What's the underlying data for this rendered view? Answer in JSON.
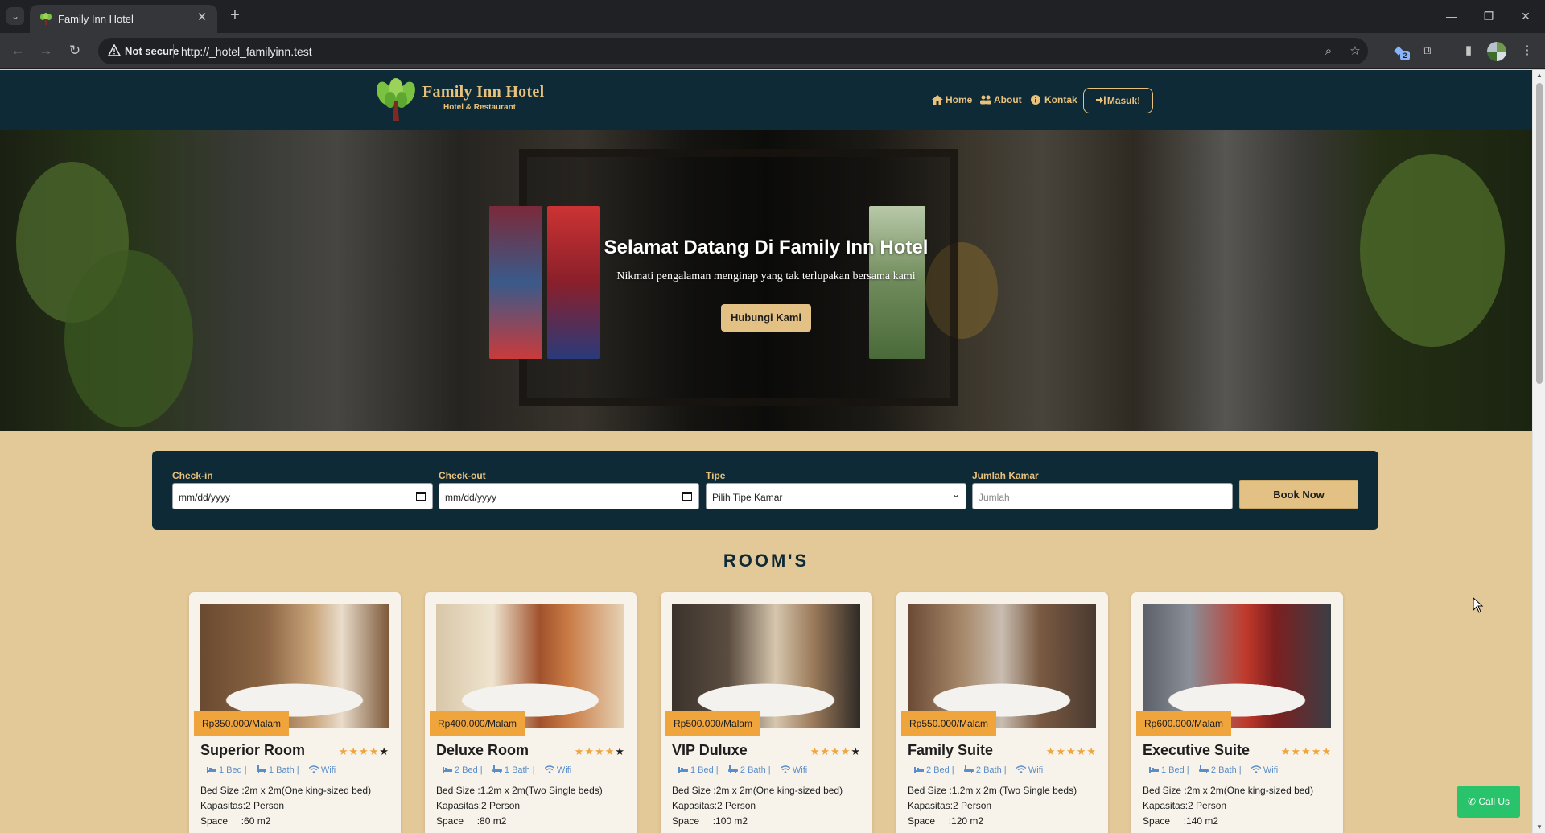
{
  "browser": {
    "tab_title": "Family Inn Hotel",
    "security_label": "Not secure",
    "url": "http://_hotel_familyinn.test",
    "extension_badge": "2"
  },
  "site": {
    "brand_name": "Family Inn Hotel",
    "brand_tagline": "Hotel & Restaurant",
    "nav": {
      "home": "Home",
      "about": "About",
      "contact": "Kontak",
      "login": "Masuk!"
    }
  },
  "hero": {
    "title": "Selamat Datang Di Family Inn Hotel",
    "subtitle": "Nikmati pengalaman menginap yang tak terlupakan bersama kami",
    "cta": "Hubungi Kami"
  },
  "booking": {
    "checkin_label": "Check-in",
    "checkin_value": "mm/dd/yyyy",
    "checkout_label": "Check-out",
    "checkout_value": "mm/dd/yyyy",
    "type_label": "Tipe",
    "type_value": "Pilih Tipe Kamar",
    "rooms_label": "Jumlah Kamar",
    "rooms_placeholder": "Jumlah",
    "submit": "Book Now"
  },
  "rooms_heading": "ROOM'S",
  "rooms": [
    {
      "name": "Superior Room",
      "price": "Rp350.000/Malam",
      "stars": 4,
      "bed": "1 Bed",
      "bath": "1 Bath",
      "wifi": "Wifi",
      "bed_size": "Bed Size  :2m x 2m(One king-sized bed)",
      "capacity": "Kapasitas:2 Person",
      "space": "Space     :60 m2"
    },
    {
      "name": "Deluxe Room",
      "price": "Rp400.000/Malam",
      "stars": 4,
      "bed": "2 Bed",
      "bath": "1 Bath",
      "wifi": "Wifi",
      "bed_size": "Bed Size  :1.2m x 2m(Two Single beds)",
      "capacity": "Kapasitas:2 Person",
      "space": "Space     :80 m2"
    },
    {
      "name": "VIP Duluxe",
      "price": "Rp500.000/Malam",
      "stars": 4,
      "bed": "1 Bed",
      "bath": "2 Bath",
      "wifi": "Wifi",
      "bed_size": "Bed Size  :2m x 2m(One king-sized bed)",
      "capacity": "Kapasitas:2 Person",
      "space": "Space     :100 m2"
    },
    {
      "name": "Family Suite",
      "price": "Rp550.000/Malam",
      "stars": 5,
      "bed": "2 Bed",
      "bath": "2 Bath",
      "wifi": "Wifi",
      "bed_size": "Bed Size  :1.2m x 2m (Two Single beds)",
      "capacity": "Kapasitas:2 Person",
      "space": "Space     :120 m2"
    },
    {
      "name": "Executive Suite",
      "price": "Rp600.000/Malam",
      "stars": 5,
      "bed": "1 Bed",
      "bath": "2 Bath",
      "wifi": "Wifi",
      "bed_size": "Bed Size  :2m x 2m(One king-sized bed)",
      "capacity": "Kapasitas:2 Person",
      "space": "Space     :140 m2"
    }
  ],
  "call_us": "Call Us",
  "colors": {
    "navy": "#0e2a36",
    "gold": "#e8c17c",
    "sand": "#e3c898",
    "price_orange": "#f0a43c",
    "whatsapp_green": "#28c36a"
  }
}
